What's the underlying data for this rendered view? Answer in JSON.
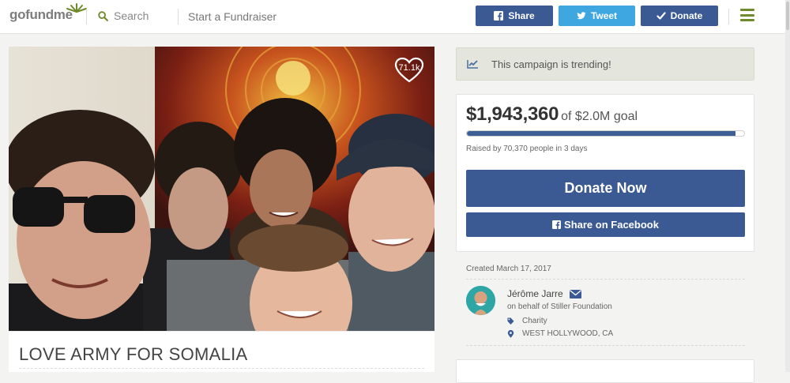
{
  "header": {
    "logo": {
      "go": "go",
      "fund": "fund",
      "me": "me"
    },
    "search_label": "Search",
    "start_label": "Start a Fundraiser",
    "share_label": "Share",
    "tweet_label": "Tweet",
    "donate_label": "Donate"
  },
  "campaign": {
    "heart_count": "71.1k",
    "title": "LOVE ARMY FOR SOMALIA"
  },
  "trending": {
    "text": "This campaign is trending!"
  },
  "progress": {
    "raised": "$1,943,360",
    "goal_text": "of $2.0M goal",
    "fraction": 0.97,
    "byline": "Raised by 70,370 people in 3 days",
    "donate_now_label": "Donate Now",
    "share_fb_label": "Share on Facebook"
  },
  "organizer": {
    "created": "Created March 17, 2017",
    "name": "Jérôme Jarre",
    "behalf": "on behalf of Stiller Foundation",
    "category": "Charity",
    "location": "WEST HOLLYWOOD, CA"
  },
  "colors": {
    "facebook_blue": "#3b5a94",
    "twitter_blue": "#3fa7e0",
    "logo_green": "#6f8a2a",
    "trend_bg": "#e4e6dd"
  }
}
